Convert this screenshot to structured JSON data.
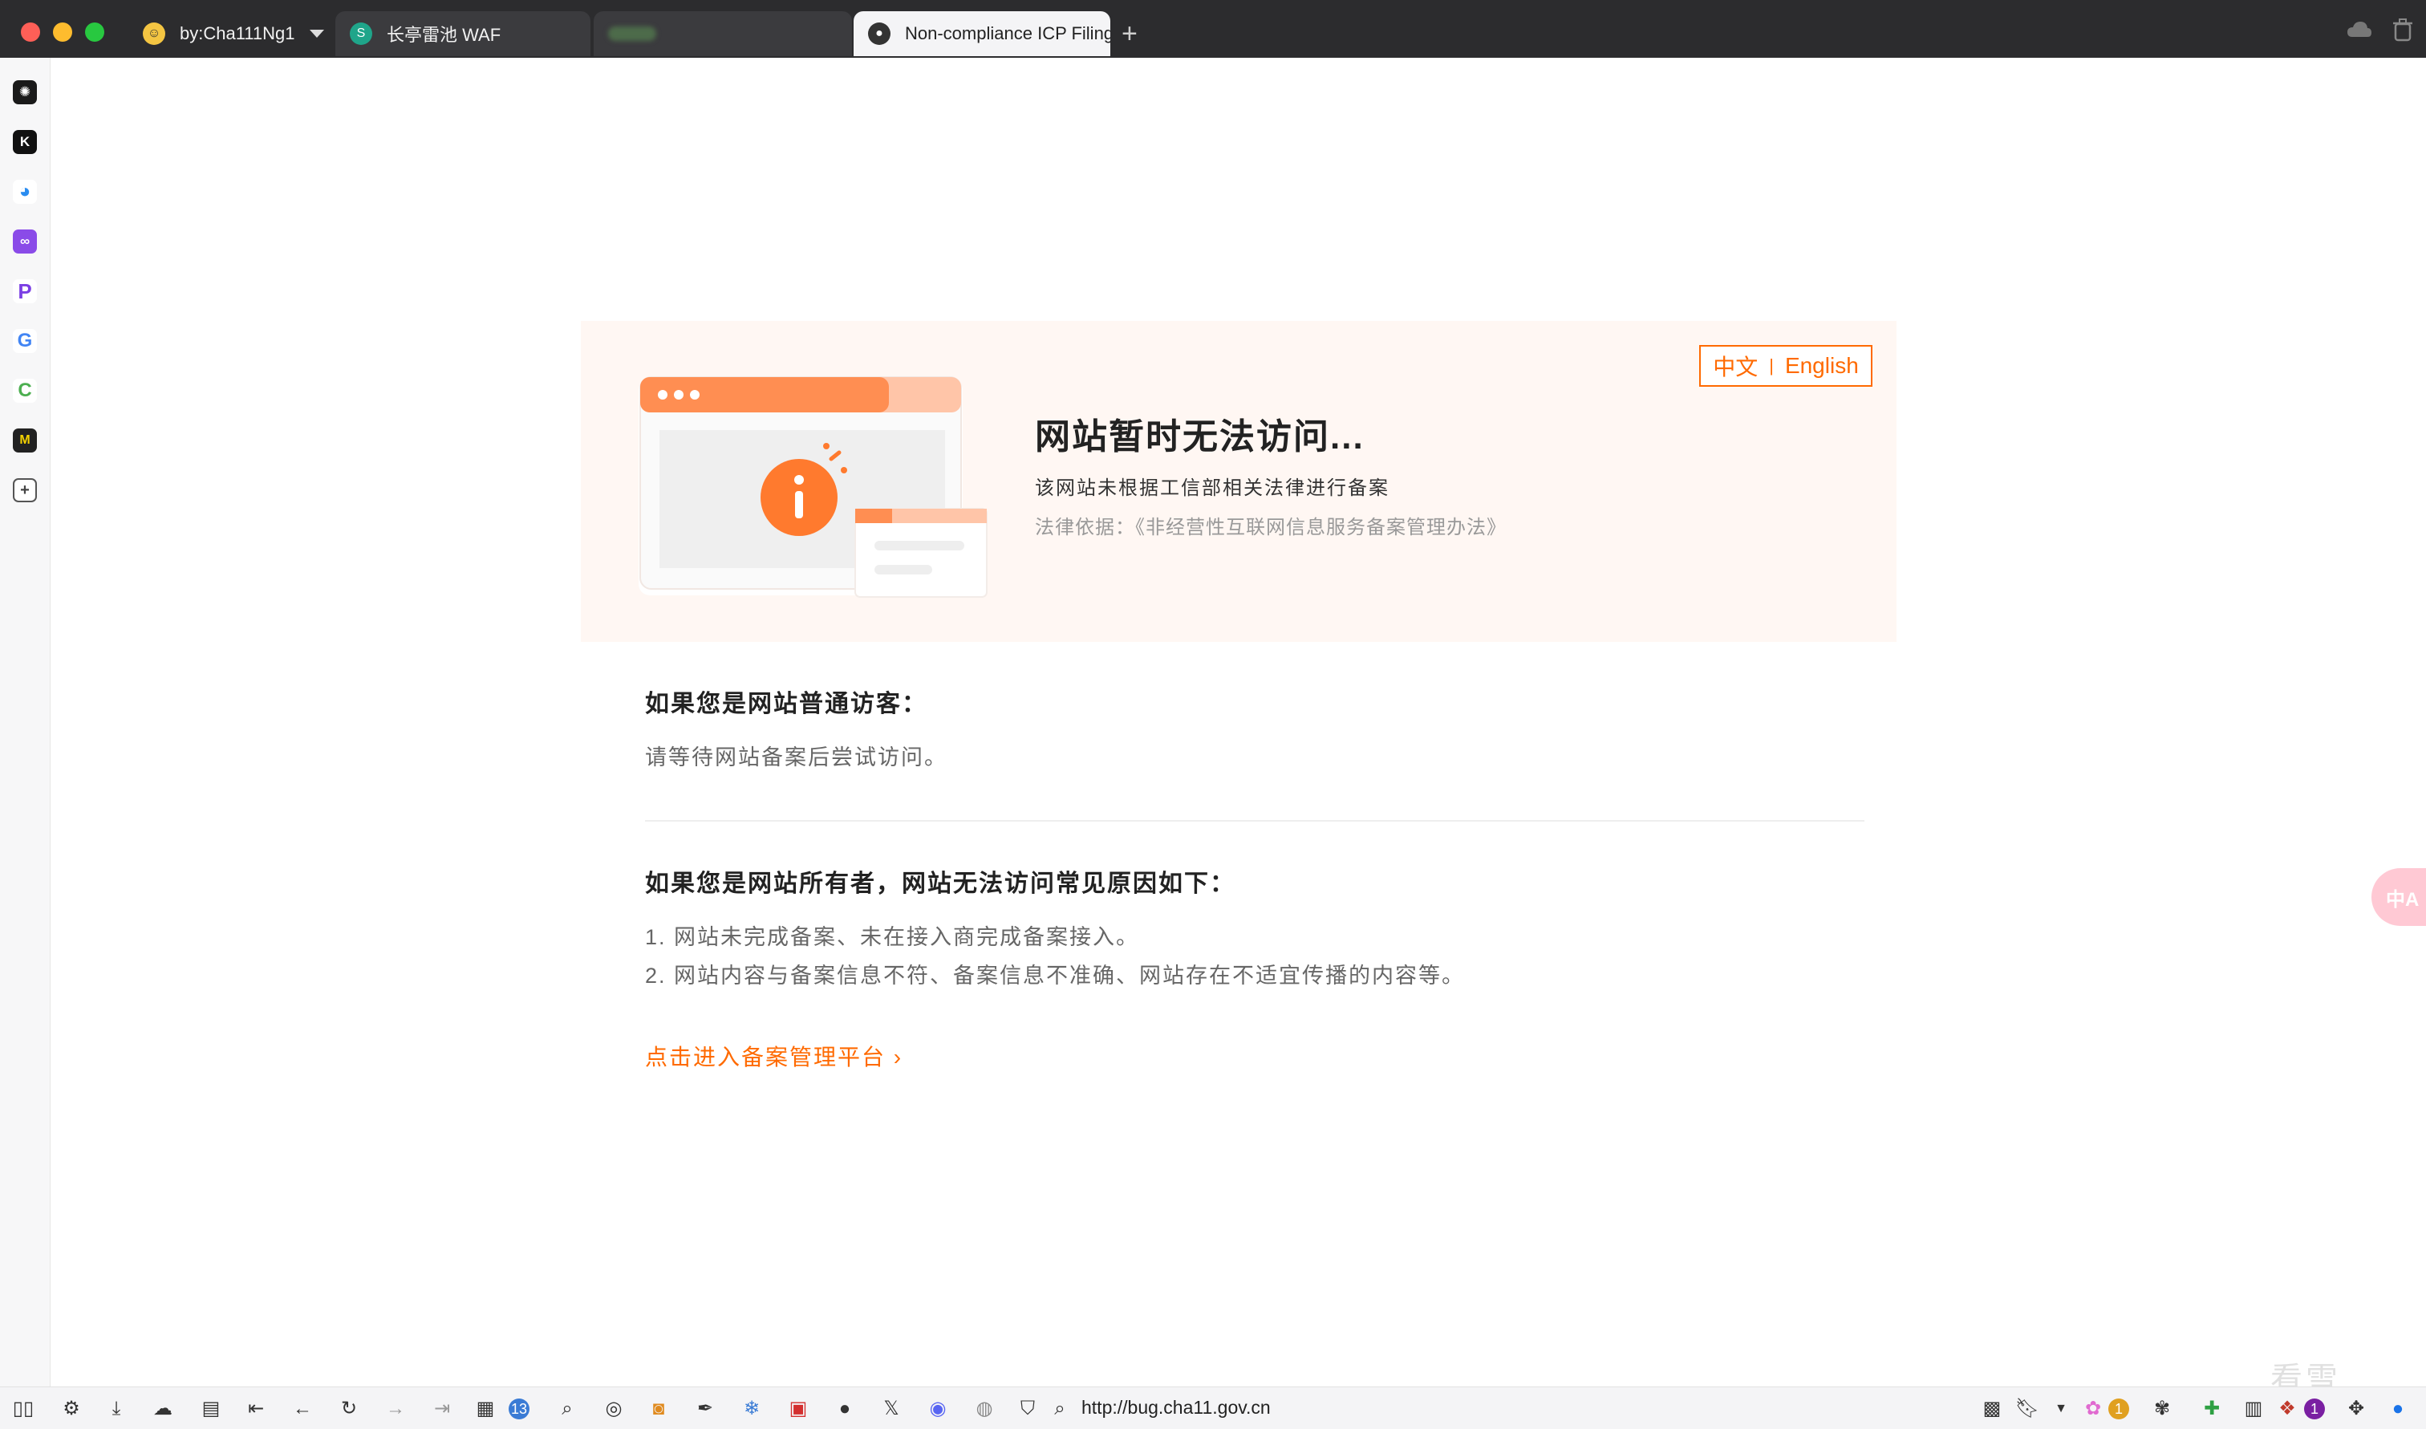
{
  "browser": {
    "tabs": [
      {
        "title": "by:Cha111Ng1",
        "favicon": "emoji-face-icon"
      },
      {
        "title": "长亭雷池 WAF",
        "favicon": "safeline-icon"
      },
      {
        "title": "",
        "favicon": "blurred-icon"
      },
      {
        "title": "Non-compliance ICP Filing",
        "favicon": "aliyun-icon"
      }
    ],
    "new_tab_label": "+",
    "sidebar_icons": [
      "openai-icon",
      "k-app-icon",
      "drop-icon",
      "chat-bot-icon",
      "p-app-icon",
      "google-icon",
      "c-app-icon",
      "m-app-icon",
      "add-panel-icon"
    ],
    "address": {
      "url": "http://bug.cha11.gov.cn"
    },
    "badges": {
      "reader_count": "13",
      "ext_badge_1": "1",
      "ext_badge_2": "1"
    },
    "translate_label": "中A"
  },
  "page": {
    "lang_switch": {
      "zh": "中文",
      "sep": "|",
      "en": "English"
    },
    "hero": {
      "title": "网站暂时无法访问...",
      "subtitle": "该网站未根据工信部相关法律进行备案",
      "law": "法律依据：《非经营性互联网信息服务备案管理办法》"
    },
    "visitor": {
      "title": "如果您是网站普通访客：",
      "text": "请等待网站备案后尝试访问。"
    },
    "owner": {
      "title": "如果您是网站所有者，网站无法访问常见原因如下：",
      "reasons": [
        "1. 网站未完成备案、未在接入商完成备案接入。",
        "2. 网站内容与备案信息不符、备案信息不准确、网站存在不适宜传播的内容等。"
      ]
    },
    "mgmt_link": "点击进入备案管理平台 ›"
  },
  "colors": {
    "accent": "#ff6a00",
    "hero_bg": "#fff7f3",
    "titlebar": "#2c2c2e"
  },
  "watermark": "看雪"
}
